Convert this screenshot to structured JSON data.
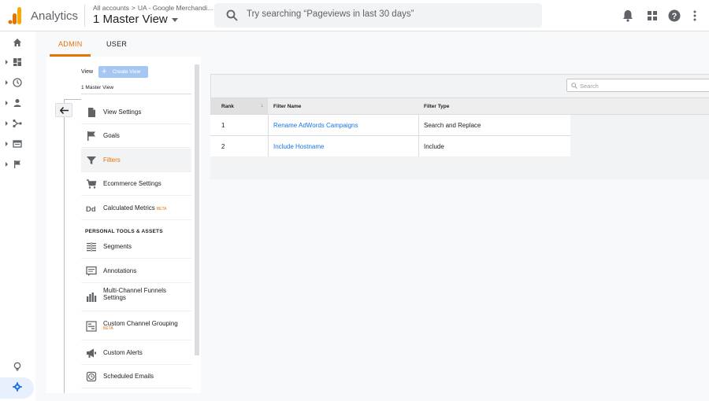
{
  "app": {
    "brand": "Analytics",
    "breadcrumb": [
      "All accounts",
      ">",
      "UA - Google Merchandi..."
    ],
    "current_view": "1 Master View",
    "search_placeholder": "Try searching “Pageviews in last 30 days”"
  },
  "tabs": {
    "admin": "ADMIN",
    "user": "USER"
  },
  "panel": {
    "view_label": "View",
    "create_view": "Create View",
    "selected_view": "1 Master View",
    "items": [
      {
        "label": "View Settings",
        "icon": "document-icon"
      },
      {
        "label": "Goals",
        "icon": "flag-icon"
      },
      {
        "label": "Filters",
        "icon": "filter-icon",
        "active": true
      },
      {
        "label": "Ecommerce Settings",
        "icon": "cart-icon"
      },
      {
        "label": "Calculated Metrics",
        "icon": "dd-icon",
        "badge": "BETA"
      }
    ],
    "section_title": "PERSONAL TOOLS & ASSETS",
    "tools": [
      {
        "label": "Segments",
        "icon": "segments-icon"
      },
      {
        "label": "Annotations",
        "icon": "annotation-icon"
      },
      {
        "label": "Multi-Channel Funnels Settings",
        "icon": "bar-chart-icon"
      },
      {
        "label": "Custom Channel Grouping",
        "icon": "grouping-icon",
        "badge": "BETA"
      },
      {
        "label": "Custom Alerts",
        "icon": "megaphone-icon"
      },
      {
        "label": "Scheduled Emails",
        "icon": "clock-icon"
      }
    ]
  },
  "filters_table": {
    "search_placeholder": "Search",
    "columns": [
      "Rank",
      "Filter Name",
      "Filter Type"
    ],
    "rows": [
      {
        "rank": "1",
        "name": "Rename AdWords Campaigns",
        "type": "Search and Replace"
      },
      {
        "rank": "2",
        "name": "Include Hostname",
        "type": "Include"
      }
    ]
  },
  "colors": {
    "accent": "#e8710a",
    "link": "#1a73e8",
    "button": "#a7c7f3"
  }
}
